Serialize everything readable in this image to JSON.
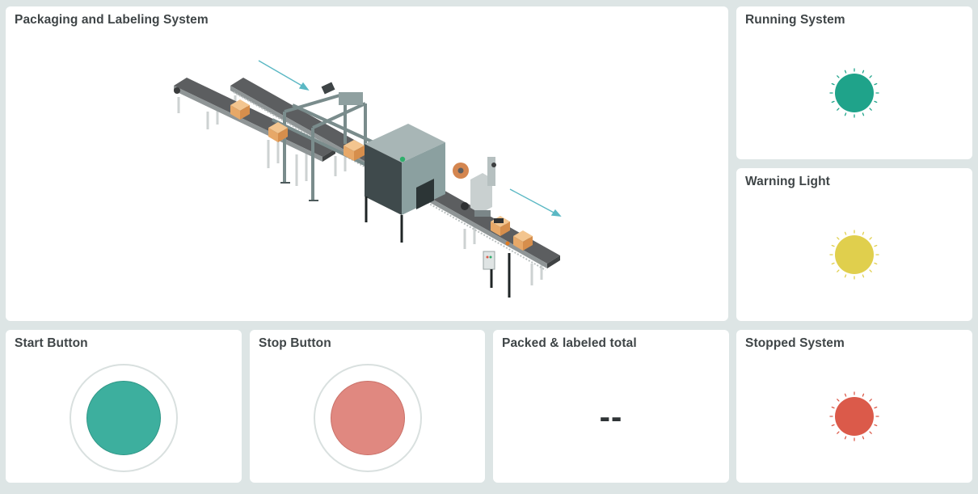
{
  "colors": {
    "page_bg": "#dde5e5",
    "card_bg": "#ffffff",
    "running_green": "#1fa38a",
    "warning_yellow": "#e0cf4d",
    "stopped_red": "#db5a4a",
    "start_button": "#3daf9e",
    "stop_button": "#e08880",
    "arrow": "#5bb8c4"
  },
  "packaging": {
    "title": "Packaging and Labeling System",
    "illustration": "packaging-line-icon"
  },
  "running": {
    "title": "Running System",
    "state": "on"
  },
  "warning": {
    "title": "Warning Light",
    "state": "on"
  },
  "start": {
    "title": "Start Button"
  },
  "stop": {
    "title": "Stop Button"
  },
  "total": {
    "title": "Packed & labeled total",
    "value": "--"
  },
  "stopped": {
    "title": "Stopped System",
    "state": "on"
  }
}
